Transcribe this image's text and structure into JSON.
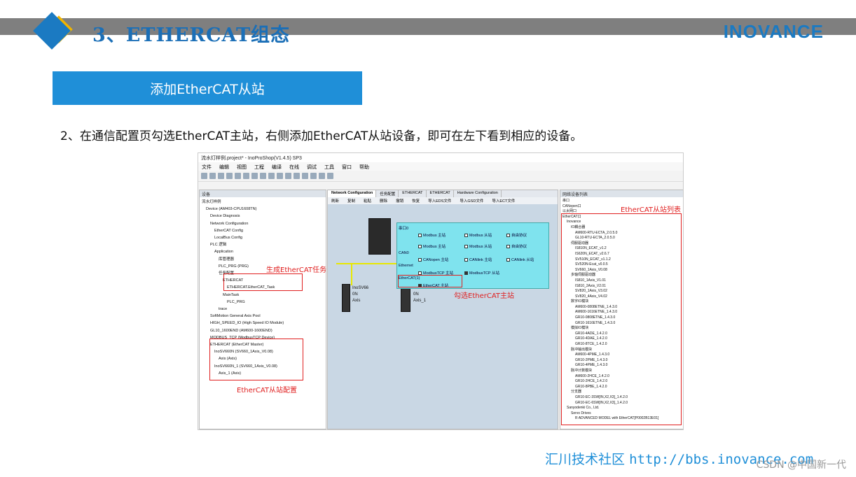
{
  "header": {
    "title": "3、ETHERCAT组态",
    "brand": "INOVANCE"
  },
  "banner": {
    "label": "添加EtherCAT从站"
  },
  "description": "2、在通信配置页勾选EtherCAT主站，右侧添加EtherCAT从站设备，即可在左下看到相应的设备。",
  "screenshot": {
    "window_title": "流水灯样例.project* - InoProShop(V1.4.5) SP3",
    "menu": [
      "文件",
      "编辑",
      "视图",
      "工程",
      "编译",
      "在线",
      "调试",
      "工具",
      "窗口",
      "帮助"
    ],
    "left_panel_title": "设备",
    "left_tree": [
      "流水灯样例",
      "Device (AM403-CPU1608TN)",
      "Device Diagnosis",
      "Network Configuration",
      "EtherCAT Config",
      "LocalBus Config",
      "PLC 逻辑",
      "Application",
      "库管理器",
      "PLC_PRG (PRG)",
      "任务配置",
      "ETHERCAT",
      "ETHERCAT.EtherCAT_Task",
      "MainTask",
      "PLC_PRG",
      "trace",
      "SoftMotion General Axis Pool",
      "HIGH_SPEED_IO (High Speed IO Module)",
      "GL10_1600END (AM600-1600END)",
      "MODBUS_TCP (ModbusTCP Device)",
      "ETHERCAT (EtherCAT Master)",
      "InoSV660N (SV660_1Axis_V0.08)",
      "Axis (Axis)",
      "InoSV660N_1 (SV660_1Axis_V0.08)",
      "Axis_1 (Axis)"
    ],
    "mid_tabs": [
      "Network Configuration",
      "任务配置",
      "ETHERCAT",
      "ETHERCAT",
      "Hardware Configuration"
    ],
    "mid_toolbar": [
      "刷新",
      "复制",
      "粘贴",
      "删除",
      "撤销",
      "恢复",
      "导入EDS文件",
      "导入GSD文件",
      "导入ECT文件"
    ],
    "cfg": {
      "serial": "串口0",
      "can": "CAN0",
      "ethernet": "Ethernet",
      "ethercat": "EtherCAT(1)",
      "options": [
        "Modbus 主站",
        "Modbus 从站",
        "自由协议",
        "Modbus 主站",
        "Modbus 从站",
        "自由协议",
        "CANopen 主站",
        "CANlink 主站",
        "CANlink 从站",
        "ModbusTCP 主站",
        "ModbusTCP 从站",
        "EtherCAT 主站"
      ]
    },
    "devices": [
      {
        "name": "InoSV66",
        "sub": "0N",
        "axis": "Axis"
      },
      {
        "name": "InoSV66",
        "sub": "0N",
        "axis": "Axis_1"
      }
    ],
    "right_panel_title": "网络设备列表",
    "right_tree": [
      "串口",
      "CANopen口",
      "以太网口",
      "EtherCAT口",
      "Inovance",
      "IO耦合器",
      "AM600-RTU-ECTA_2.0.5.0",
      "GL10-RTU-ECTA_2.0.5.0",
      "伺服驱动器",
      "IS810N_ECAT_v1.2",
      "IS620N_ECAT_v2.6.7",
      "SV510N_ECAT_v1.1.2",
      "SV520N-Ecat_v0.0.5",
      "SV660_1Axis_V0.08",
      "多轴伺服驱动器",
      "IS810_1Axis_V1.01",
      "IS810_2Axis_V2.01",
      "SV820_1Axis_V3.02",
      "SV820_4Axis_V4.02",
      "数字IO模块",
      "AM600-0808ETNE_1.4.3.0",
      "AM600-1616ETNE_1.4.3.0",
      "GR10-0808ETNE_1.4.3.0",
      "GR10-1616ETNE_1.4.3.0",
      "模拟IO模块",
      "GR10-4ADE_1.4.2.0",
      "GR10-4DAE_1.4.2.0",
      "GR10-8TCE_1.4.2.0",
      "脉冲输出模块",
      "AM600-4PME_1.4.3.0",
      "GR10-2PME_1.4.3.0",
      "GR10-4PME_1.4.3.0",
      "脉冲计数模块",
      "AM600-2HCE_1.4.2.0",
      "GR10-2HCE_1.4.2.0",
      "GR10-8PBE_1.4.2.0",
      "分支器",
      "GR10-EC-3SW[IN,X2,X3]_1.4.2.0",
      "GR10-EC-6SW[IN,X2,X3]_1.4.2.0",
      "Sanyodenki Co., Ltd.",
      "Servo Drives",
      "R ADVANCED MODEL with EtherCAT[P0002B13E01]"
    ],
    "annotations": {
      "task": "生成EtherCAT任务",
      "master": "勾选EtherCAT主站",
      "slave_cfg": "EtherCAT从站配置",
      "slave_list": "EtherCAT从站列表"
    }
  },
  "footer": {
    "community": "汇川技术社区",
    "url": "http://bbs.inovance.com"
  },
  "watermark": "CSDN @中国新一代",
  "colors": {
    "accent": "#1b7ac2",
    "banner": "#1f8fd8",
    "annotation": "#e02020",
    "topbar": "#7f7f7f",
    "highlight": "#f0b400"
  }
}
